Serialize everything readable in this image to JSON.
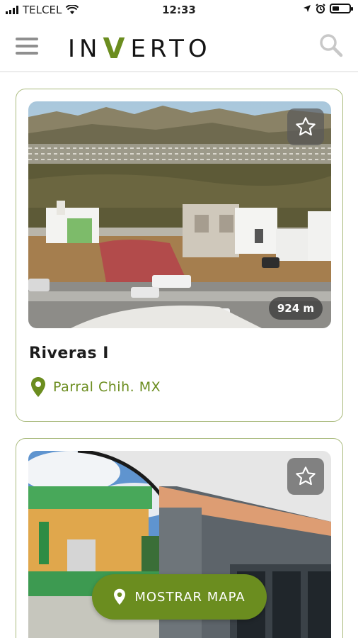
{
  "status_bar": {
    "carrier": "TELCEL",
    "time": "12:33"
  },
  "header": {
    "logo_text_left": "IN",
    "logo_letter_accent": "V",
    "logo_text_right": "ERTO",
    "menu_icon": "hamburger-menu-icon",
    "search_icon": "search-icon"
  },
  "listings": [
    {
      "title": "Riveras I",
      "location": "Parral Chih. MX",
      "distance": "924 m",
      "favorite_icon": "star-outline-icon",
      "location_icon": "map-pin-icon"
    },
    {
      "favorite_icon": "star-outline-icon"
    }
  ],
  "map_button": {
    "label": "MOSTRAR MAPA",
    "icon": "map-pin-icon"
  },
  "colors": {
    "brand_green": "#6b8d1f",
    "card_border": "#a9ba7c",
    "divider": "#ececec"
  }
}
